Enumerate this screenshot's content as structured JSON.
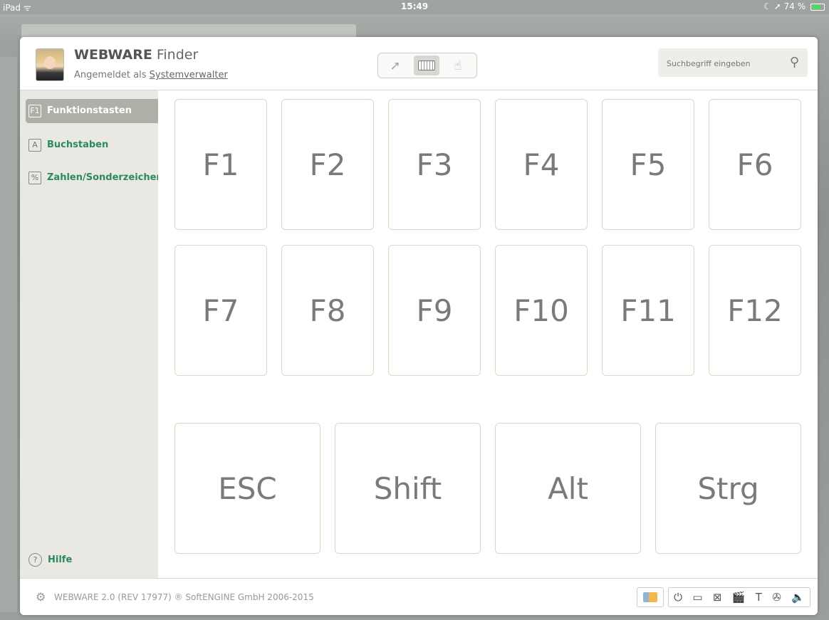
{
  "status_bar": {
    "device": "iPad",
    "wifi": "ᯤ",
    "time": "15:49",
    "battery": "74 %"
  },
  "header": {
    "brand": "WEBWARE",
    "app": "Finder",
    "logged_in_prefix": "Angemeldet als",
    "user": "Systemverwalter",
    "search_placeholder": "Suchbegriff eingeben"
  },
  "sidebar": {
    "items": [
      {
        "key": "F1",
        "label": "Funktionstasten",
        "active": true
      },
      {
        "key": "A",
        "label": "Buchstaben",
        "active": false
      },
      {
        "key": "%",
        "label": "Zahlen/Sonderzeichen",
        "active": false
      }
    ],
    "help_label": "Hilfe",
    "help_icon": "?"
  },
  "keys": {
    "function_keys": [
      "F1",
      "F2",
      "F3",
      "F4",
      "F5",
      "F6",
      "F7",
      "F8",
      "F9",
      "F10",
      "F11",
      "F12"
    ],
    "modifier_keys": [
      "ESC",
      "Shift",
      "Alt",
      "Strg"
    ]
  },
  "footer": {
    "version": "WEBWARE 2.0 (REV 17977) ® SoftENGINE GmbH 2006-2015"
  },
  "colors": {
    "accent": "#2b8a5d",
    "active_sidebar": "#aeb0a8",
    "key_border": "#ddd8bf"
  }
}
